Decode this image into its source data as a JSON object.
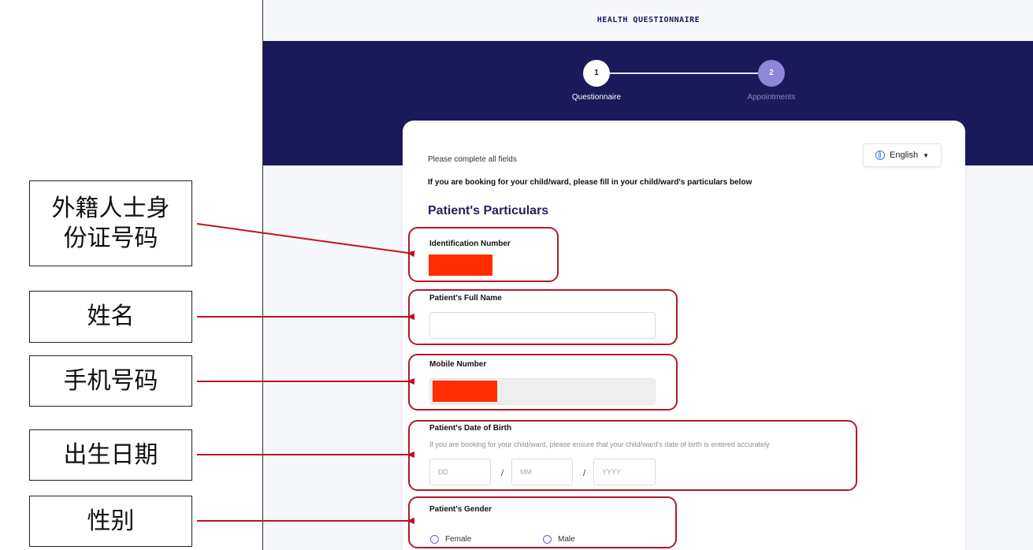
{
  "header": {
    "title": "HEALTH QUESTIONNAIRE"
  },
  "stepper": {
    "steps": [
      {
        "number": "1",
        "label": "Questionnaire"
      },
      {
        "number": "2",
        "label": "Appointments"
      }
    ]
  },
  "language": {
    "value": "English"
  },
  "form": {
    "hint": "Please complete all fields",
    "guardian_note": "If you are booking for your child/ward, please fill in your child/ward's particulars below",
    "section_title": "Patient's Particulars",
    "identification_label": "Identification Number",
    "full_name_label": "Patient's Full Name",
    "mobile_label": "Mobile Number",
    "dob_label": "Patient's Date of Birth",
    "dob_hint": "If you are booking for your child/ward, please ensure that your child/ward's date of birth is entered accurately",
    "dob_placeholders": {
      "day": "DD",
      "month": "MM",
      "year": "YYYY"
    },
    "dob_separator": "/",
    "gender_label": "Patient's Gender",
    "gender_options": [
      "Female",
      "Male"
    ]
  },
  "annotations": [
    "外籍人士身份证号码",
    "姓名",
    "手机号码",
    "出生日期",
    "性别"
  ],
  "colors": {
    "band": "#1a1a5a",
    "highlight": "#b01a2a",
    "redaction": "#ff2d00"
  }
}
